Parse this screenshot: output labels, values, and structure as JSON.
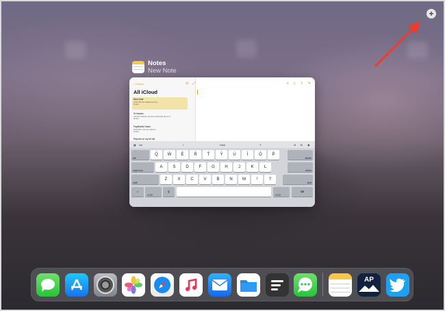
{
  "space_add_icon": "plus-icon",
  "annotation_color": "#f03a2a",
  "app": {
    "name": "Notes",
    "window_subtitle": "New Note",
    "icon": "notes-app-icon"
  },
  "notes_window": {
    "folders_button": "< Folders",
    "list_title": "All iCloud",
    "notes": [
      {
        "title": "New Note",
        "meta": "3:46 PM  No additional text",
        "folder": "Notes"
      },
      {
        "title": "Hi Hasten,",
        "meta": "12/4/21  Please find the attached file and",
        "folder": "Notes"
      },
      {
        "title": "PayMobile Notes",
        "meta": "10/12/21  Get the feature",
        "folder": "Notes"
      },
      {
        "title": "Reports on my Mr list",
        "meta": "",
        "folder": ""
      }
    ]
  },
  "keyboard": {
    "toolbar": {
      "format": "Aa",
      "suggestion": "How",
      "left_mark": "I",
      "right_mark": "Y"
    },
    "row1": [
      "Q",
      "W",
      "E",
      "R",
      "T",
      "Y",
      "U",
      "I",
      "O",
      "P"
    ],
    "row1_sub": [
      "1",
      "2",
      "3",
      "4",
      "5",
      "6",
      "7",
      "8",
      "9",
      "0"
    ],
    "row2": [
      "A",
      "S",
      "D",
      "F",
      "G",
      "H",
      "J",
      "K",
      "L"
    ],
    "row3": [
      "Z",
      "X",
      "C",
      "V",
      "B",
      "N",
      "M",
      "!",
      "?"
    ],
    "row3_sub": [
      "",
      "",
      "",
      "",
      "",
      "",
      "",
      ",",
      "."
    ],
    "tab": "tab",
    "delete": "delete",
    "caps_lock": "caps lock",
    "return": "return",
    "shift_left": "shift",
    "shift_right": "shift",
    "numbers_left": ".?123",
    "numbers_right": ".?123"
  },
  "dock": {
    "apps": [
      "Messages",
      "App Store",
      "Settings",
      "Photos",
      "Safari",
      "Music",
      "Mail",
      "Files",
      "Notes Writer",
      "Messages Chat",
      "Notes",
      "AP News",
      "Twitter"
    ],
    "ap_label": "AP"
  }
}
